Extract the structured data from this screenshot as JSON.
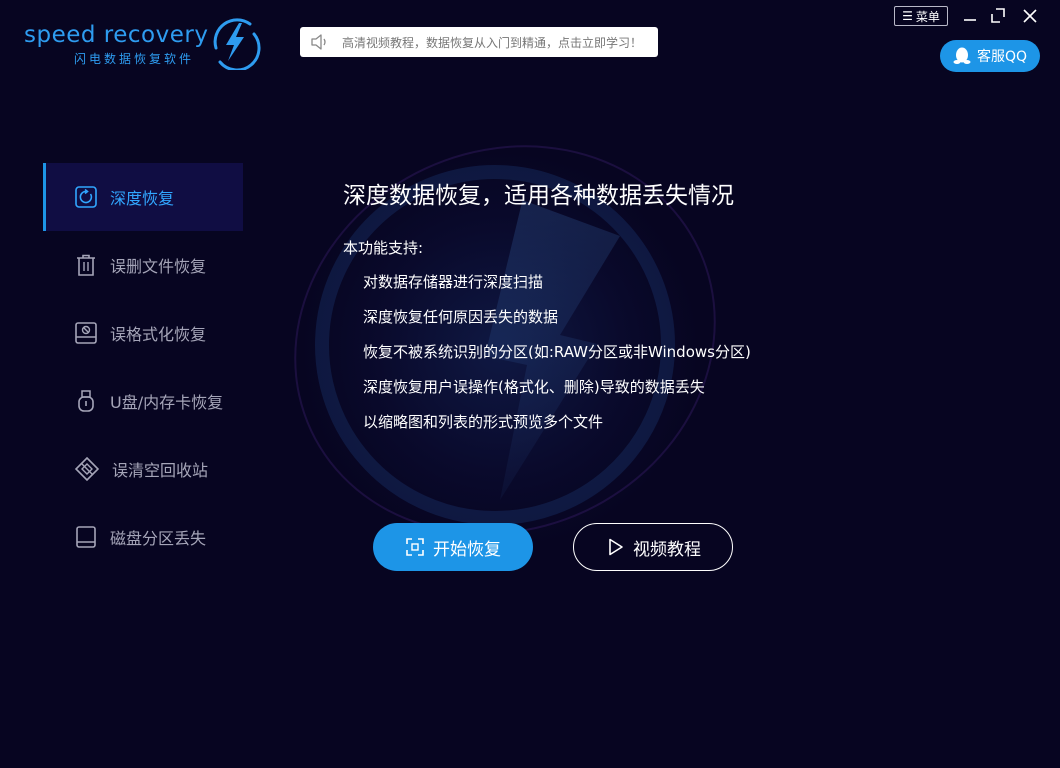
{
  "app": {
    "logo_text": "speed recovery",
    "logo_subtitle": "闪电数据恢复软件",
    "brand_color": "#1d95e7",
    "background": "#070521"
  },
  "header": {
    "notice_text": "高清视频教程，数据恢复从入门到精通，点击立即学习！",
    "notice_icon": "speaker-icon",
    "menu_label": "菜单",
    "minimize_icon": "minimize-icon",
    "maximize_icon": "maximize-icon",
    "close_icon": "close-icon",
    "support_label": "客服QQ",
    "support_icon": "qq-penguin-icon"
  },
  "sidebar": {
    "items": [
      {
        "label": "深度恢复",
        "icon": "deep-recovery-icon",
        "active": true
      },
      {
        "label": "误删文件恢复",
        "icon": "trash-icon",
        "active": false
      },
      {
        "label": "误格式化恢复",
        "icon": "format-disk-icon",
        "active": false
      },
      {
        "label": "U盘/内存卡恢复",
        "icon": "usb-icon",
        "active": false
      },
      {
        "label": "误清空回收站",
        "icon": "recycle-bin-icon",
        "active": false
      },
      {
        "label": "磁盘分区丢失",
        "icon": "disk-partition-icon",
        "active": false
      }
    ]
  },
  "main": {
    "title": "深度数据恢复，适用各种数据丢失情况",
    "support_label": "本功能支持:",
    "features": [
      "对数据存储器进行深度扫描",
      "深度恢复任何原因丢失的数据",
      "恢复不被系统识别的分区(如:RAW分区或非Windows分区)",
      "深度恢复用户误操作(格式化、删除)导致的数据丢失",
      "以缩略图和列表的形式预览多个文件"
    ],
    "start_button": "开始恢复",
    "video_button": "视频教程"
  }
}
